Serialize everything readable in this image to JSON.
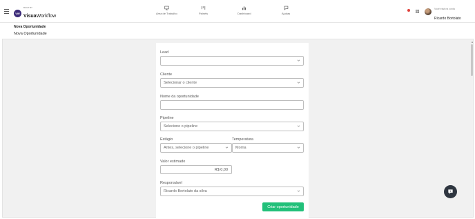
{
  "app": {
    "logo_badge": "VW",
    "logo_small": "BUILT BY",
    "logo_main_bold": "Visua",
    "logo_main_light": "Workflow"
  },
  "nav": [
    {
      "label": "Área de Trabalho",
      "icon": "monitor-icon"
    },
    {
      "label": "Painéis",
      "icon": "kanban-icon"
    },
    {
      "label": "Dashboard",
      "icon": "bar-chart-icon"
    },
    {
      "label": "Ajudas",
      "icon": "chat-icon"
    }
  ],
  "user": {
    "subtitle": "Você está na conta",
    "name": "Ricardo Bortolato"
  },
  "breadcrumb": "Nova Oportunidade",
  "page_title": "Nova Oportunidade",
  "form": {
    "lead_label": "Lead",
    "lead_value": "",
    "cliente_label": "Cliente",
    "cliente_value": "Selecionar o cliente",
    "nome_label": "Nome da oportunidade",
    "nome_value": "",
    "pipeline_label": "Pipeline",
    "pipeline_value": "Selecione o pipeline",
    "estagio_label": "Estágio",
    "estagio_value": "Antes, selecione o pipeline",
    "temperatura_label": "Temperatura",
    "temperatura_value": "Morna",
    "valor_label": "Valor estimado",
    "valor_value": "R$ 0,00",
    "responsavel_label": "Responsável",
    "responsavel_value": "Ricardo Bortolato da silva",
    "submit_label": "Criar oportunidade"
  },
  "colors": {
    "accent": "#22c07a",
    "brand": "#3b2a78",
    "fab": "#2f3640"
  }
}
